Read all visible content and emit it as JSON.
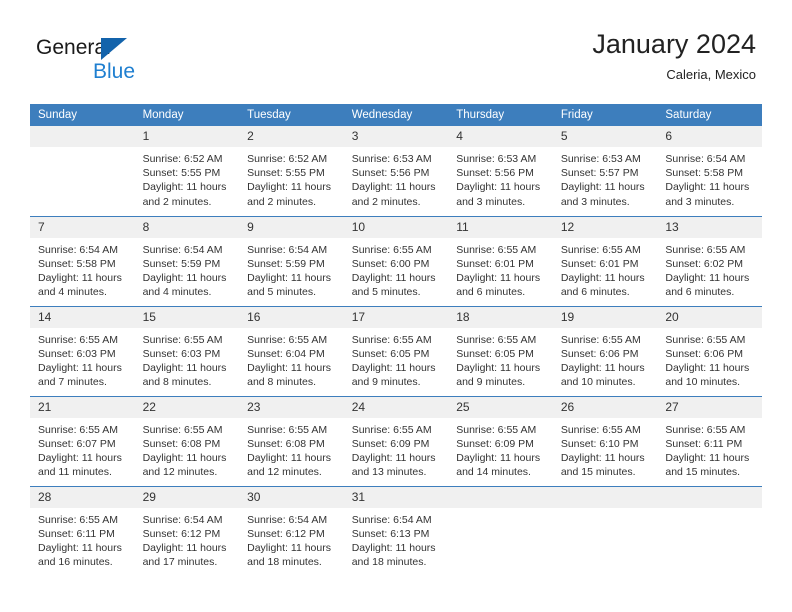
{
  "brand": {
    "name_part1": "General",
    "name_part2": "Blue",
    "triangle_color": "#1363ab",
    "blue_color": "#1f7fd0"
  },
  "header": {
    "title": "January 2024",
    "subtitle": "Caleria, Mexico"
  },
  "theme": {
    "header_row_bg": "#3d7ebd",
    "daynum_bg": "#f0f0f0",
    "text_color": "#333333"
  },
  "columns": [
    "Sunday",
    "Monday",
    "Tuesday",
    "Wednesday",
    "Thursday",
    "Friday",
    "Saturday"
  ],
  "labels": {
    "sunrise_prefix": "Sunrise:",
    "sunset_prefix": "Sunset:",
    "daylight_prefix": "Daylight:"
  },
  "weeks": [
    [
      {
        "day": "",
        "line1": "",
        "line2": "",
        "line3": "",
        "line4": ""
      },
      {
        "day": "1",
        "line1": "Sunrise: 6:52 AM",
        "line2": "Sunset: 5:55 PM",
        "line3": "Daylight: 11 hours",
        "line4": "and 2 minutes."
      },
      {
        "day": "2",
        "line1": "Sunrise: 6:52 AM",
        "line2": "Sunset: 5:55 PM",
        "line3": "Daylight: 11 hours",
        "line4": "and 2 minutes."
      },
      {
        "day": "3",
        "line1": "Sunrise: 6:53 AM",
        "line2": "Sunset: 5:56 PM",
        "line3": "Daylight: 11 hours",
        "line4": "and 2 minutes."
      },
      {
        "day": "4",
        "line1": "Sunrise: 6:53 AM",
        "line2": "Sunset: 5:56 PM",
        "line3": "Daylight: 11 hours",
        "line4": "and 3 minutes."
      },
      {
        "day": "5",
        "line1": "Sunrise: 6:53 AM",
        "line2": "Sunset: 5:57 PM",
        "line3": "Daylight: 11 hours",
        "line4": "and 3 minutes."
      },
      {
        "day": "6",
        "line1": "Sunrise: 6:54 AM",
        "line2": "Sunset: 5:58 PM",
        "line3": "Daylight: 11 hours",
        "line4": "and 3 minutes."
      }
    ],
    [
      {
        "day": "7",
        "line1": "Sunrise: 6:54 AM",
        "line2": "Sunset: 5:58 PM",
        "line3": "Daylight: 11 hours",
        "line4": "and 4 minutes."
      },
      {
        "day": "8",
        "line1": "Sunrise: 6:54 AM",
        "line2": "Sunset: 5:59 PM",
        "line3": "Daylight: 11 hours",
        "line4": "and 4 minutes."
      },
      {
        "day": "9",
        "line1": "Sunrise: 6:54 AM",
        "line2": "Sunset: 5:59 PM",
        "line3": "Daylight: 11 hours",
        "line4": "and 5 minutes."
      },
      {
        "day": "10",
        "line1": "Sunrise: 6:55 AM",
        "line2": "Sunset: 6:00 PM",
        "line3": "Daylight: 11 hours",
        "line4": "and 5 minutes."
      },
      {
        "day": "11",
        "line1": "Sunrise: 6:55 AM",
        "line2": "Sunset: 6:01 PM",
        "line3": "Daylight: 11 hours",
        "line4": "and 6 minutes."
      },
      {
        "day": "12",
        "line1": "Sunrise: 6:55 AM",
        "line2": "Sunset: 6:01 PM",
        "line3": "Daylight: 11 hours",
        "line4": "and 6 minutes."
      },
      {
        "day": "13",
        "line1": "Sunrise: 6:55 AM",
        "line2": "Sunset: 6:02 PM",
        "line3": "Daylight: 11 hours",
        "line4": "and 6 minutes."
      }
    ],
    [
      {
        "day": "14",
        "line1": "Sunrise: 6:55 AM",
        "line2": "Sunset: 6:03 PM",
        "line3": "Daylight: 11 hours",
        "line4": "and 7 minutes."
      },
      {
        "day": "15",
        "line1": "Sunrise: 6:55 AM",
        "line2": "Sunset: 6:03 PM",
        "line3": "Daylight: 11 hours",
        "line4": "and 8 minutes."
      },
      {
        "day": "16",
        "line1": "Sunrise: 6:55 AM",
        "line2": "Sunset: 6:04 PM",
        "line3": "Daylight: 11 hours",
        "line4": "and 8 minutes."
      },
      {
        "day": "17",
        "line1": "Sunrise: 6:55 AM",
        "line2": "Sunset: 6:05 PM",
        "line3": "Daylight: 11 hours",
        "line4": "and 9 minutes."
      },
      {
        "day": "18",
        "line1": "Sunrise: 6:55 AM",
        "line2": "Sunset: 6:05 PM",
        "line3": "Daylight: 11 hours",
        "line4": "and 9 minutes."
      },
      {
        "day": "19",
        "line1": "Sunrise: 6:55 AM",
        "line2": "Sunset: 6:06 PM",
        "line3": "Daylight: 11 hours",
        "line4": "and 10 minutes."
      },
      {
        "day": "20",
        "line1": "Sunrise: 6:55 AM",
        "line2": "Sunset: 6:06 PM",
        "line3": "Daylight: 11 hours",
        "line4": "and 10 minutes."
      }
    ],
    [
      {
        "day": "21",
        "line1": "Sunrise: 6:55 AM",
        "line2": "Sunset: 6:07 PM",
        "line3": "Daylight: 11 hours",
        "line4": "and 11 minutes."
      },
      {
        "day": "22",
        "line1": "Sunrise: 6:55 AM",
        "line2": "Sunset: 6:08 PM",
        "line3": "Daylight: 11 hours",
        "line4": "and 12 minutes."
      },
      {
        "day": "23",
        "line1": "Sunrise: 6:55 AM",
        "line2": "Sunset: 6:08 PM",
        "line3": "Daylight: 11 hours",
        "line4": "and 12 minutes."
      },
      {
        "day": "24",
        "line1": "Sunrise: 6:55 AM",
        "line2": "Sunset: 6:09 PM",
        "line3": "Daylight: 11 hours",
        "line4": "and 13 minutes."
      },
      {
        "day": "25",
        "line1": "Sunrise: 6:55 AM",
        "line2": "Sunset: 6:09 PM",
        "line3": "Daylight: 11 hours",
        "line4": "and 14 minutes."
      },
      {
        "day": "26",
        "line1": "Sunrise: 6:55 AM",
        "line2": "Sunset: 6:10 PM",
        "line3": "Daylight: 11 hours",
        "line4": "and 15 minutes."
      },
      {
        "day": "27",
        "line1": "Sunrise: 6:55 AM",
        "line2": "Sunset: 6:11 PM",
        "line3": "Daylight: 11 hours",
        "line4": "and 15 minutes."
      }
    ],
    [
      {
        "day": "28",
        "line1": "Sunrise: 6:55 AM",
        "line2": "Sunset: 6:11 PM",
        "line3": "Daylight: 11 hours",
        "line4": "and 16 minutes."
      },
      {
        "day": "29",
        "line1": "Sunrise: 6:54 AM",
        "line2": "Sunset: 6:12 PM",
        "line3": "Daylight: 11 hours",
        "line4": "and 17 minutes."
      },
      {
        "day": "30",
        "line1": "Sunrise: 6:54 AM",
        "line2": "Sunset: 6:12 PM",
        "line3": "Daylight: 11 hours",
        "line4": "and 18 minutes."
      },
      {
        "day": "31",
        "line1": "Sunrise: 6:54 AM",
        "line2": "Sunset: 6:13 PM",
        "line3": "Daylight: 11 hours",
        "line4": "and 18 minutes."
      },
      {
        "day": "",
        "line1": "",
        "line2": "",
        "line3": "",
        "line4": ""
      },
      {
        "day": "",
        "line1": "",
        "line2": "",
        "line3": "",
        "line4": ""
      },
      {
        "day": "",
        "line1": "",
        "line2": "",
        "line3": "",
        "line4": ""
      }
    ]
  ]
}
